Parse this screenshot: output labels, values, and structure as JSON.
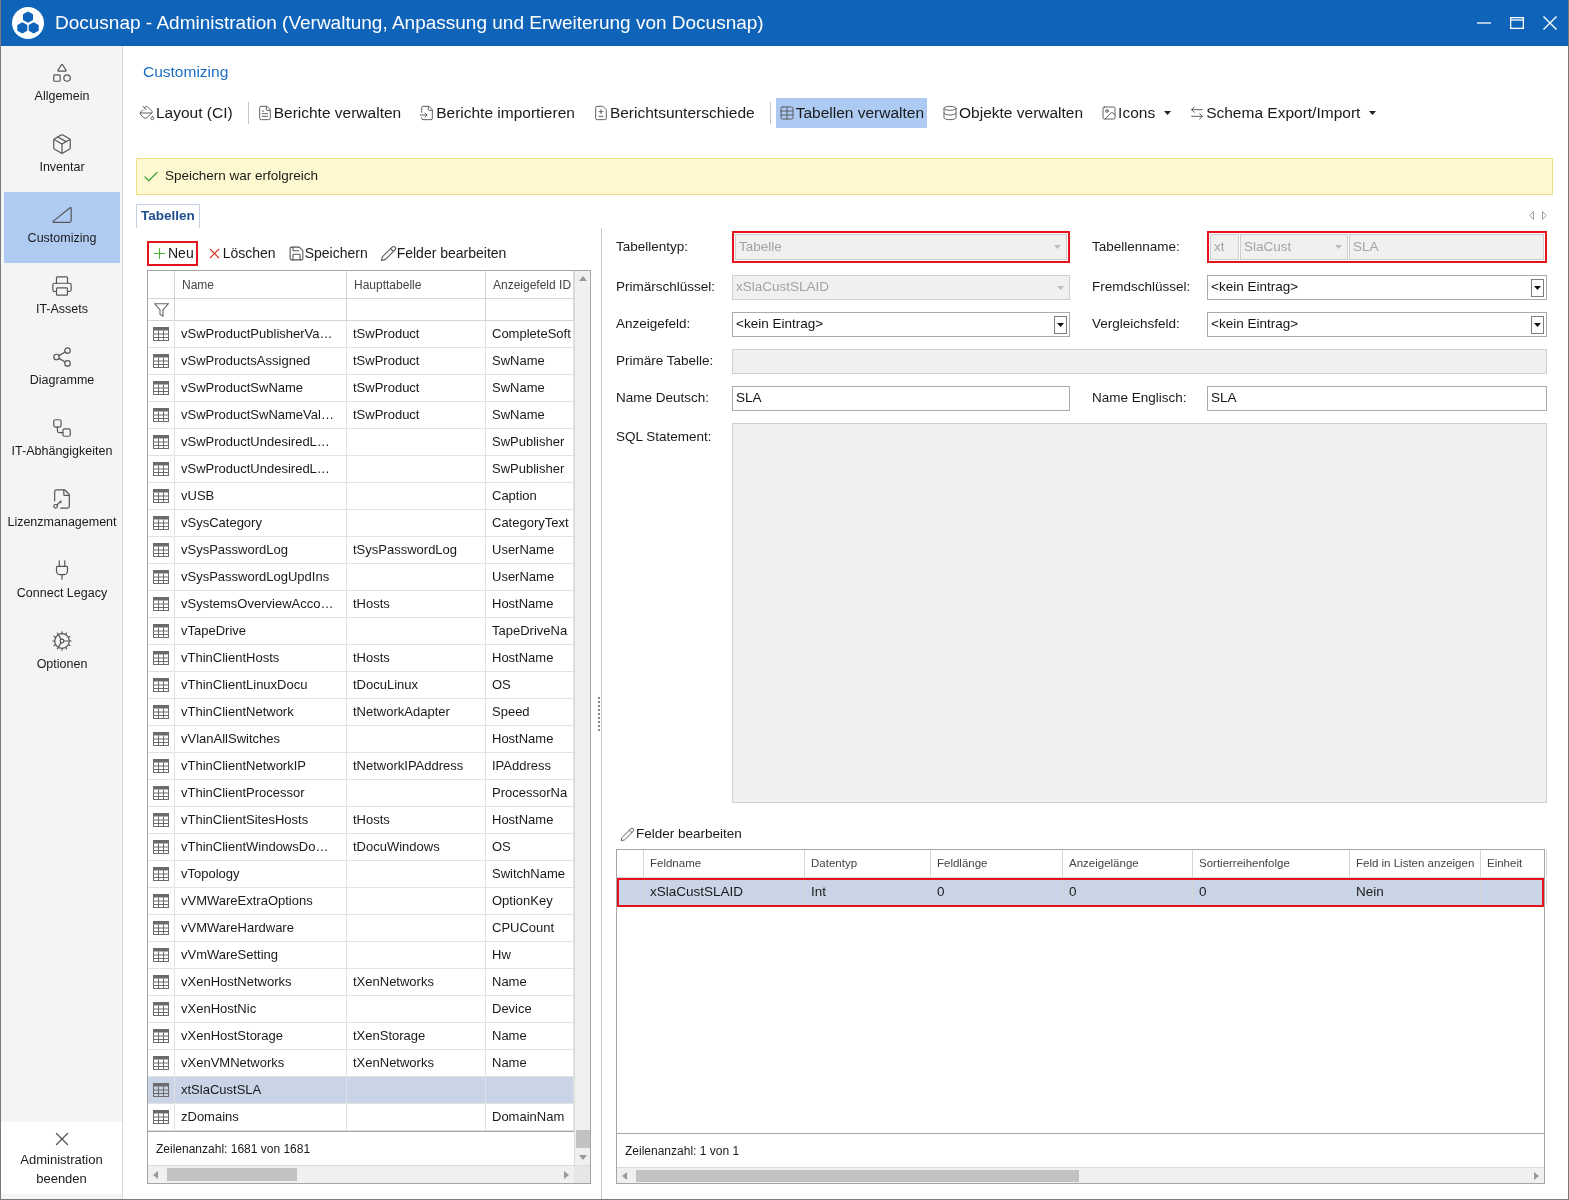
{
  "window": {
    "title": "Docusnap - Administration (Verwaltung, Anpassung und Erweiterung von Docusnap)"
  },
  "sidebar": {
    "items": [
      {
        "label": "Allgemein",
        "selected": false
      },
      {
        "label": "Inventar",
        "selected": false
      },
      {
        "label": "Customizing",
        "selected": true
      },
      {
        "label": "IT-Assets",
        "selected": false
      },
      {
        "label": "Diagramme",
        "selected": false
      },
      {
        "label": "IT-Abhängigkeiten",
        "selected": false
      },
      {
        "label": "Lizenzmanagement",
        "selected": false
      },
      {
        "label": "Connect Legacy",
        "selected": false
      },
      {
        "label": "Optionen",
        "selected": false
      }
    ],
    "exit_button": {
      "label": "Administration beenden"
    }
  },
  "breadcrumb": "Customizing",
  "toolbar": {
    "groups": [
      [
        {
          "label": "Layout (CI)",
          "selected": false,
          "dropdown": false
        }
      ],
      [
        {
          "label": "Berichte verwalten",
          "selected": false,
          "dropdown": false
        },
        {
          "label": "Berichte importieren",
          "selected": false,
          "dropdown": false
        },
        {
          "label": "Berichtsunterschiede",
          "selected": false,
          "dropdown": false
        }
      ],
      [
        {
          "label": "Tabellen verwalten",
          "selected": true,
          "dropdown": false
        },
        {
          "label": "Objekte verwalten",
          "selected": false,
          "dropdown": false
        },
        {
          "label": "Icons",
          "selected": false,
          "dropdown": true
        },
        {
          "label": "Schema Export/Import",
          "selected": false,
          "dropdown": true
        }
      ]
    ]
  },
  "notification": {
    "kind": "success",
    "text": "Speichern war erfolgreich"
  },
  "tabs": [
    {
      "label": "Tabellen",
      "selected": true
    }
  ],
  "tables_panel": {
    "actions": [
      {
        "label": "Neu",
        "highlighted": true
      },
      {
        "label": "Löschen",
        "highlighted": false
      },
      {
        "label": "Speichern",
        "highlighted": false
      },
      {
        "label": "Felder bearbeiten",
        "highlighted": false
      }
    ],
    "columns": [
      "Name",
      "Haupttabelle",
      "Anzeigefeld ID"
    ],
    "rows": [
      {
        "name": "vSwProductPublisherVa…",
        "main_table": "tSwProduct",
        "display_field": "CompleteSoft",
        "selected": false
      },
      {
        "name": "vSwProductsAssigned",
        "main_table": "tSwProduct",
        "display_field": "SwName",
        "selected": false
      },
      {
        "name": "vSwProductSwName",
        "main_table": "tSwProduct",
        "display_field": "SwName",
        "selected": false
      },
      {
        "name": "vSwProductSwNameVal…",
        "main_table": "tSwProduct",
        "display_field": "SwName",
        "selected": false
      },
      {
        "name": "vSwProductUndesiredL…",
        "display_field": "SwPublisher",
        "selected": false
      },
      {
        "name": "vSwProductUndesiredL…",
        "display_field": "SwPublisher",
        "selected": false
      },
      {
        "name": "vUSB",
        "display_field": "Caption",
        "selected": false
      },
      {
        "name": "vSysCategory",
        "display_field": "CategoryText",
        "selected": false
      },
      {
        "name": "vSysPasswordLog",
        "main_table": "tSysPasswordLog",
        "display_field": "UserName",
        "selected": false
      },
      {
        "name": "vSysPasswordLogUpdIns",
        "display_field": "UserName",
        "selected": false
      },
      {
        "name": "vSystemsOverviewAcco…",
        "main_table": "tHosts",
        "display_field": "HostName",
        "selected": false
      },
      {
        "name": "vTapeDrive",
        "display_field": "TapeDriveNa",
        "selected": false
      },
      {
        "name": "vThinClientHosts",
        "main_table": "tHosts",
        "display_field": "HostName",
        "selected": false
      },
      {
        "name": "vThinClientLinuxDocu",
        "main_table": "tDocuLinux",
        "display_field": "OS",
        "selected": false
      },
      {
        "name": "vThinClientNetwork",
        "main_table": "tNetworkAdapter",
        "display_field": "Speed",
        "selected": false
      },
      {
        "name": "vVlanAllSwitches",
        "display_field": "HostName",
        "selected": false
      },
      {
        "name": "vThinClientNetworkIP",
        "main_table": "tNetworkIPAddress",
        "display_field": "IPAddress",
        "selected": false
      },
      {
        "name": "vThinClientProcessor",
        "display_field": "ProcessorNa",
        "selected": false
      },
      {
        "name": "vThinClientSitesHosts",
        "main_table": "tHosts",
        "display_field": "HostName",
        "selected": false
      },
      {
        "name": "vThinClientWindowsDo…",
        "main_table": "tDocuWindows",
        "display_field": "OS",
        "selected": false
      },
      {
        "name": "vTopology",
        "display_field": "SwitchName",
        "selected": false
      },
      {
        "name": "vVMWareExtraOptions",
        "display_field": "OptionKey",
        "selected": false
      },
      {
        "name": "vVMWareHardware",
        "display_field": "CPUCount",
        "selected": false
      },
      {
        "name": "vVmWareSetting",
        "display_field": "Hw",
        "selected": false
      },
      {
        "name": "vXenHostNetworks",
        "main_table": "tXenNetworks",
        "display_field": "Name",
        "selected": false
      },
      {
        "name": "vXenHostNic",
        "display_field": "Device",
        "selected": false
      },
      {
        "name": "vXenHostStorage",
        "main_table": "tXenStorage",
        "display_field": "Name",
        "selected": false
      },
      {
        "name": "vXenVMNetworks",
        "main_table": "tXenNetworks",
        "display_field": "Name",
        "selected": false
      },
      {
        "name": "xtSlaCustSLA",
        "selected": true
      },
      {
        "name": "zDomains",
        "display_field": "DomainNam",
        "selected": false
      }
    ],
    "footer": "Zeilenanzahl: 1681 von 1681"
  },
  "form": {
    "rows": [
      [
        {
          "label": "Tabellentyp:",
          "kind": "combo",
          "value": "Tabelle",
          "disabled": true,
          "highlighted": true
        },
        {
          "label": "Tabellenname:",
          "kind": "name_parts",
          "highlighted": true,
          "parts": [
            {
              "kind": "text",
              "value": "xt",
              "disabled": true
            },
            {
              "kind": "combo",
              "value": "SlaCust",
              "disabled": true
            },
            {
              "kind": "text",
              "value": "SLA",
              "disabled": true
            }
          ]
        }
      ],
      [
        {
          "label": "Primärschlüssel:",
          "kind": "combo",
          "value": "xSlaCustSLAID",
          "disabled": true,
          "highlighted": false
        },
        {
          "label": "Fremdschlüssel:",
          "kind": "combo",
          "value": "<kein Eintrag>",
          "disabled": false,
          "highlighted": false
        }
      ],
      [
        {
          "label": "Anzeigefeld:",
          "kind": "combo",
          "value": "<kein Eintrag>",
          "disabled": false,
          "highlighted": false
        },
        {
          "label": "Vergleichsfeld:",
          "kind": "combo",
          "value": "<kein Eintrag>",
          "disabled": false,
          "highlighted": false
        }
      ],
      [
        {
          "label": "Primäre Tabelle:",
          "kind": "text",
          "disabled": true,
          "highlighted": false
        }
      ],
      [
        {
          "label": "Name Deutsch:",
          "kind": "text",
          "value": "SLA",
          "disabled": false,
          "highlighted": false
        },
        {
          "label": "Name Englisch:",
          "kind": "text",
          "value": "SLA",
          "disabled": false,
          "highlighted": false
        }
      ],
      [
        {
          "label": "SQL Statement:",
          "kind": "textarea",
          "disabled": true,
          "highlighted": false
        }
      ]
    ]
  },
  "fields_panel": {
    "action": {
      "label": "Felder bearbeiten"
    },
    "columns": [
      "Feldname",
      "Datentyp",
      "Feldlänge",
      "Anzeigelänge",
      "Sortierreihenfolge",
      "Feld in Listen anzeigen",
      "Einheit"
    ],
    "rows": [
      {
        "field_name": "xSlaCustSLAID",
        "data_type": "Int",
        "field_length": "0",
        "display_length": "0",
        "sort_order": "0",
        "show_in_lists": "Nein",
        "selected": true,
        "highlighted": true
      }
    ],
    "footer": "Zeilenanzahl: 1 von 1"
  }
}
